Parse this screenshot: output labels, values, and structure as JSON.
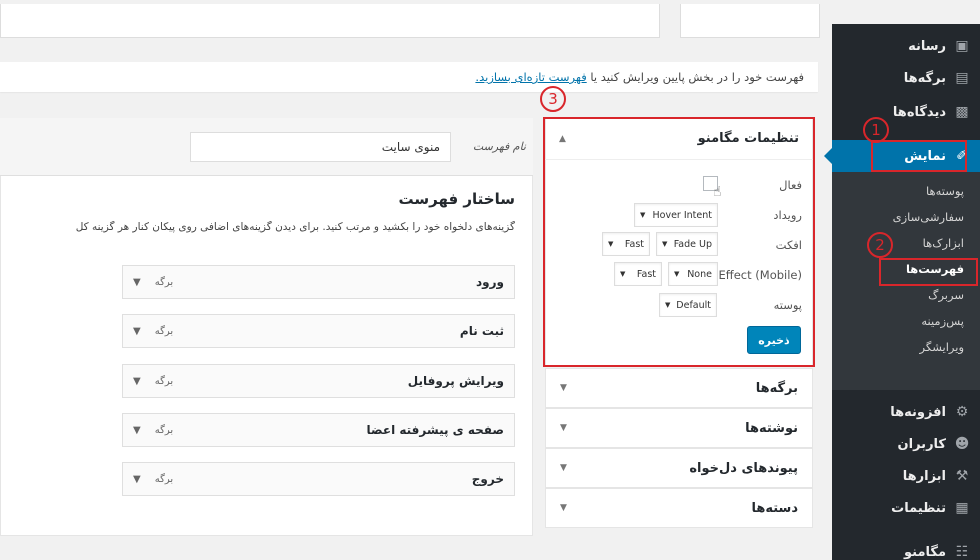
{
  "colors": {
    "sidebar_bg": "#23282d",
    "accent": "#0073aa",
    "annotation_red": "#d9262b",
    "primary_button": "#0085ba"
  },
  "annotations": [
    "1",
    "2",
    "3"
  ],
  "sidebar": {
    "items": [
      {
        "label": "رسانه",
        "icon": "media-icon"
      },
      {
        "label": "برگه‌ها",
        "icon": "pages-icon"
      },
      {
        "label": "دیدگاه‌ها",
        "icon": "comments-icon"
      },
      {
        "label": "نمایش",
        "icon": "appearance-icon"
      },
      {
        "label": "افزونه‌ها",
        "icon": "plugins-icon"
      },
      {
        "label": "کاربران",
        "icon": "users-icon"
      },
      {
        "label": "ابزارها",
        "icon": "tools-icon"
      },
      {
        "label": "تنظیمات",
        "icon": "settings-icon"
      },
      {
        "label": "مگامنو",
        "icon": "megamenu-icon"
      }
    ],
    "submenu": [
      "پوسته‌ها",
      "سفارشی‌سازی",
      "ابزارک‌ها",
      "فهرست‌ها",
      "سربرگ",
      "پس‌زمینه",
      "ویرایشگر"
    ]
  },
  "notice": {
    "text": "فهرست خود را در بخش پایین ویرایش کنید یا",
    "link": "فهرست تازه‌ای بسازید."
  },
  "megamenu": {
    "title": "تنظیمات مگامنو",
    "rows": {
      "active_label": "فعال",
      "event_label": "رویداد",
      "event_value": "Hover Intent",
      "effect_label": "افکت",
      "effect_value": "Fade Up",
      "effect_speed": "Fast",
      "effect_mobile_label": "(Effect (Mobile",
      "mobile_value": "None",
      "mobile_speed": "Fast",
      "theme_label": "پوسته",
      "theme_value": "Default"
    },
    "save": "ذخیره"
  },
  "accordion": [
    "برگه‌ها",
    "نوشته‌ها",
    "پیوندهای دل‌خواه",
    "دسته‌ها"
  ],
  "menu_name": {
    "label": "نام فهرست",
    "value": "منوی سایت"
  },
  "structure": {
    "title": "ساختار فهرست",
    "desc": "گزینه‌های دلخواه خود را بکشید و مرتب کنید. برای دیدن گزینه‌های اضافی روی پیکان کنار هر گزینه کل",
    "item_type": "برگه",
    "items": [
      "ورود",
      "ثبت نام",
      "ویرایش پروفایل",
      "صفحه ی پیشرفته اعضا",
      "خروج"
    ]
  }
}
